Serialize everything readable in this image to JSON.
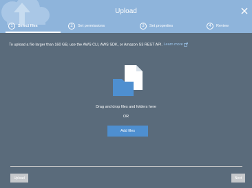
{
  "dialog": {
    "title": "Upload",
    "close_icon": "close-icon",
    "steps": [
      {
        "number": "1",
        "label": "Select files",
        "active": true
      },
      {
        "number": "2",
        "label": "Set permissions",
        "active": false
      },
      {
        "number": "3",
        "label": "Set properties",
        "active": false
      },
      {
        "number": "4",
        "label": "Review",
        "active": false
      }
    ],
    "info_text": "To upload a file larger than 160 GB, use the AWS CLI, AWS SDK, or Amazon S3 REST API.",
    "learn_more": "Learn more",
    "illustration_icon": "folder-file-icon",
    "drag_text": "Drag and drop files and folders here",
    "or_text": "OR",
    "add_files_label": "Add files",
    "upload_label": "Upload",
    "next_label": "Next"
  },
  "colors": {
    "header": "#8eb4db",
    "body": "#5a6b7b",
    "accent": "#4e8fd0",
    "disabled_button": "#c5c8cb"
  }
}
